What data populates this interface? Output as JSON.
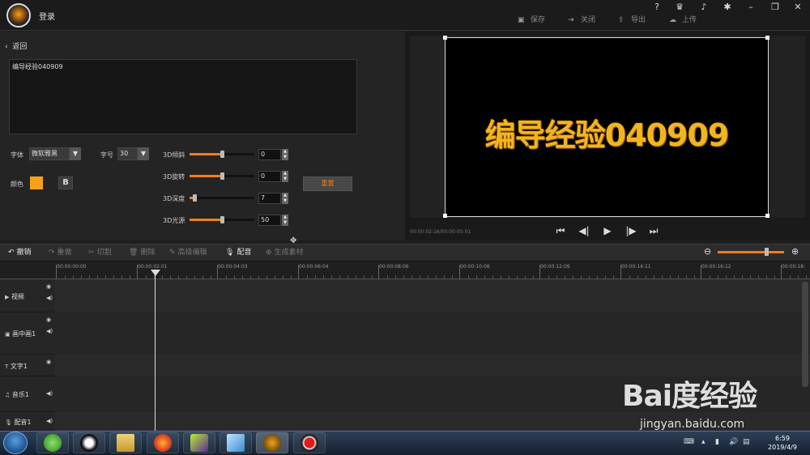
{
  "titlebar": {
    "login": "登录",
    "actions": {
      "save": "保存",
      "close": "关闭",
      "export": "导出",
      "upload": "上传"
    },
    "icons": [
      "help-icon",
      "vip-icon",
      "bell-icon",
      "gear-icon",
      "minimize-icon",
      "maximize-icon",
      "close-window-icon"
    ]
  },
  "editor": {
    "back": "返回",
    "text_content": "编导经验040909",
    "font_label": "字体",
    "font_value": "微软雅黑",
    "size_label": "字号",
    "size_value": "30",
    "color_label": "颜色",
    "color_value": "#f5a21b",
    "bold_label": "B",
    "sliders": [
      {
        "label": "3D倾斜",
        "value": "0",
        "level": 0.5
      },
      {
        "label": "3D旋转",
        "value": "0",
        "level": 0.5
      },
      {
        "label": "3D深度",
        "value": "7",
        "level": 0.07
      },
      {
        "label": "3D光源",
        "value": "50",
        "level": 0.5
      }
    ],
    "reset": "重置"
  },
  "preview": {
    "text": "编导经验040909",
    "timecode": "00:00:02:16/00:00:05:01"
  },
  "toolbar": {
    "undo": "撤销",
    "redo": "重做",
    "cut": "切割",
    "delete": "删除",
    "advanced": "高级编辑",
    "dub": "配音",
    "generate": "生成素材"
  },
  "ruler": {
    "ticks": [
      "00:00:00:00",
      "00:00:02:01",
      "00:00:04:03",
      "00:00:06:04",
      "00:00:08:06",
      "00:00:10:08",
      "00:00:12:09",
      "00:00:14:11",
      "00:00:16:12",
      "00:00:18:"
    ]
  },
  "tracks": [
    {
      "name": "视频",
      "icon": "video-icon"
    },
    {
      "name": "画中画1",
      "icon": "pip-icon"
    },
    {
      "name": "文字1",
      "icon": "text-icon"
    },
    {
      "name": "音乐1",
      "icon": "music-icon"
    },
    {
      "name": "配音1",
      "icon": "mic-icon"
    }
  ],
  "taskbar": {
    "time": "6:59",
    "date": "2019/4/9"
  },
  "watermark": {
    "logo": "Bai度经验",
    "url": "jingyan.baidu.com"
  }
}
